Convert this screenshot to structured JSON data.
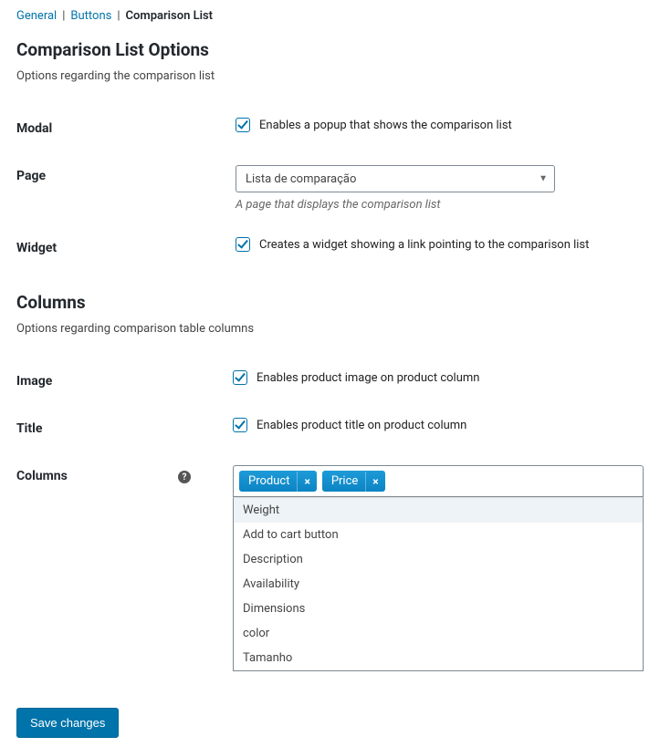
{
  "nav": {
    "general": "General",
    "buttons": "Buttons",
    "current": "Comparison List"
  },
  "section1": {
    "title": "Comparison List Options",
    "desc": "Options regarding the comparison list"
  },
  "fields": {
    "modal": {
      "label": "Modal",
      "checkbox_text": "Enables a popup that shows the comparison list",
      "checked": true
    },
    "page": {
      "label": "Page",
      "selected": "Lista de comparação",
      "help": "A page that displays the comparison list"
    },
    "widget": {
      "label": "Widget",
      "checkbox_text": "Creates a widget showing a link pointing to the comparison list",
      "checked": true
    }
  },
  "section2": {
    "title": "Columns",
    "desc": "Options regarding comparison table columns"
  },
  "colfields": {
    "image": {
      "label": "Image",
      "checkbox_text": "Enables product image on product column",
      "checked": true
    },
    "title": {
      "label": "Title",
      "checkbox_text": "Enables product title on product column",
      "checked": true
    },
    "columns": {
      "label": "Columns",
      "selected": [
        "Product",
        "Price"
      ],
      "options": [
        "Weight",
        "Add to cart button",
        "Description",
        "Availability",
        "Dimensions",
        "color",
        "Tamanho"
      ]
    }
  },
  "submit": {
    "label": "Save changes"
  }
}
